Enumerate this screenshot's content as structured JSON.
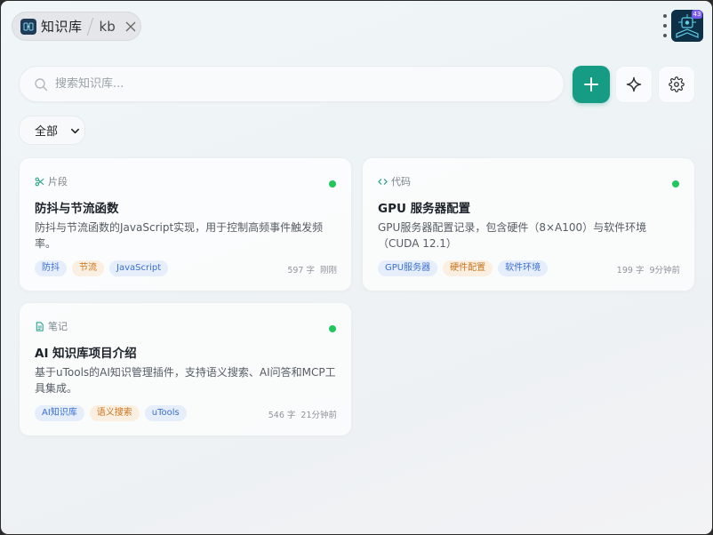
{
  "window": {
    "tab_title": "知识库",
    "tab_keyword": "kb",
    "avatar_badge": "43"
  },
  "search": {
    "placeholder": "搜索知识库..."
  },
  "toolbar": {
    "add_icon": "plus-icon",
    "ai_icon": "sparkle-icon",
    "settings_icon": "gear-icon"
  },
  "filter": {
    "selected": "全部"
  },
  "colors": {
    "accent": "#169b85",
    "status_active": "#22c55e",
    "tag_blue": "#3a6fd0",
    "tag_orange": "#c9741c"
  },
  "cards": [
    {
      "type_label": "片段",
      "type_icon": "scissors-icon",
      "title": "防抖与节流函数",
      "description": "防抖与节流函数的JavaScript实现，用于控制高频事件触发频率。",
      "tags": [
        {
          "label": "防抖",
          "color": "blue"
        },
        {
          "label": "节流",
          "color": "orange"
        },
        {
          "label": "JavaScript",
          "color": "blue"
        }
      ],
      "word_count": "597 字",
      "time": "刚刚"
    },
    {
      "type_label": "代码",
      "type_icon": "code-icon",
      "title": "GPU 服务器配置",
      "description": "GPU服务器配置记录，包含硬件（8×A100）与软件环境（CUDA 12.1）",
      "tags": [
        {
          "label": "GPU服务器",
          "color": "blue"
        },
        {
          "label": "硬件配置",
          "color": "orange"
        },
        {
          "label": "软件环境",
          "color": "blue"
        }
      ],
      "word_count": "199 字",
      "time": "9分钟前"
    },
    {
      "type_label": "笔记",
      "type_icon": "document-icon",
      "title": "AI 知识库项目介绍",
      "description": "基于uTools的AI知识管理插件，支持语义搜索、AI问答和MCP工具集成。",
      "tags": [
        {
          "label": "AI知识库",
          "color": "blue"
        },
        {
          "label": "语义搜索",
          "color": "orange"
        },
        {
          "label": "uTools",
          "color": "blue"
        }
      ],
      "word_count": "546 字",
      "time": "21分钟前"
    }
  ]
}
